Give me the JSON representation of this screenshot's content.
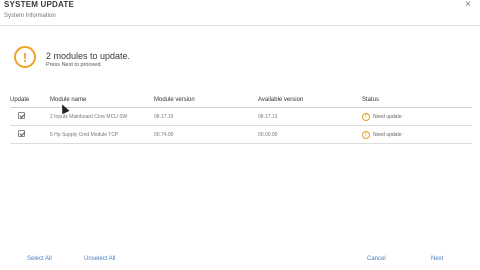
{
  "dialog": {
    "title": "SYSTEM UPDATE",
    "subtitle": "System Information",
    "close_glyph": "×"
  },
  "notice": {
    "icon": "warning-circle-icon",
    "icon_glyph": "!",
    "title": "2 modules to update.",
    "subtitle": "Press Next to proceed.",
    "color": "#f0a22b"
  },
  "table": {
    "headers": {
      "update": "Update",
      "module_name": "Module name",
      "module_version": "Module version",
      "available_version": "Available version",
      "status": "Status"
    },
    "rows": [
      {
        "checked": true,
        "module_name": "2 Inputs Mainboard Core MCU SW",
        "module_version": "08.17.10",
        "available_version": "08.17.13",
        "status": "Need update",
        "status_icon_glyph": "!"
      },
      {
        "checked": true,
        "module_name": "5 Hp Supply Cmd Module TCP",
        "module_version": "00.74.00",
        "available_version": "00.00.00",
        "status": "Need update",
        "status_icon_glyph": "!"
      }
    ]
  },
  "footer": {
    "select_all": "Select All",
    "unselect_all": "Unselect All",
    "cancel": "Cancel",
    "next": "Next",
    "link_color": "#4a7fc1"
  }
}
